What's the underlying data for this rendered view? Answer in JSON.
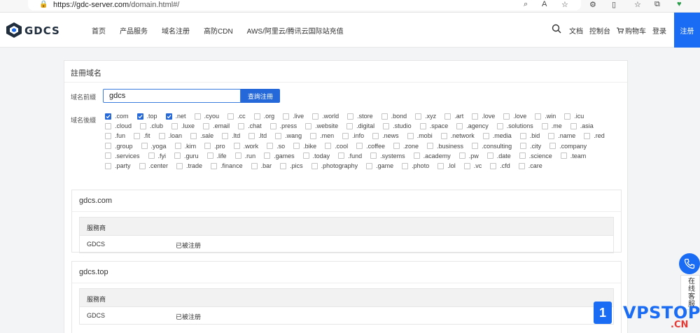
{
  "browser": {
    "url_host": "https://gdc-server.com",
    "url_path": "/domain.html#/"
  },
  "header": {
    "logo_text": "GDCS",
    "nav": [
      "首页",
      "产品服务",
      "域名注册",
      "高防CDN",
      "AWS/阿里云/腾讯云国际站充值"
    ],
    "docs": "文档",
    "console": "控制台",
    "cart": "购物车",
    "login": "登录",
    "register": "注册"
  },
  "panel": {
    "title": "註冊域名",
    "prefix_label": "域名前綴",
    "prefix_value": "gdcs",
    "query_button": "查詢注冊",
    "suffix_label": "域名後綴"
  },
  "tlds": [
    {
      "name": ".com",
      "checked": true
    },
    {
      "name": ".top",
      "checked": true
    },
    {
      "name": ".net",
      "checked": true
    },
    {
      "name": ".cyou",
      "checked": false
    },
    {
      "name": ".cc",
      "checked": false
    },
    {
      "name": ".org",
      "checked": false
    },
    {
      "name": ".live",
      "checked": false
    },
    {
      "name": ".world",
      "checked": false
    },
    {
      "name": ".store",
      "checked": false
    },
    {
      "name": ".bond",
      "checked": false
    },
    {
      "name": ".xyz",
      "checked": false
    },
    {
      "name": ".art",
      "checked": false
    },
    {
      "name": ".love",
      "checked": false
    },
    {
      "name": ".love",
      "checked": false
    },
    {
      "name": ".win",
      "checked": false
    },
    {
      "name": ".icu",
      "checked": false
    },
    {
      "name": ".cloud",
      "checked": false
    },
    {
      "name": ".club",
      "checked": false
    },
    {
      "name": ".luxe",
      "checked": false
    },
    {
      "name": ".email",
      "checked": false
    },
    {
      "name": ".chat",
      "checked": false
    },
    {
      "name": ".press",
      "checked": false
    },
    {
      "name": ".website",
      "checked": false
    },
    {
      "name": ".digital",
      "checked": false
    },
    {
      "name": ".studio",
      "checked": false
    },
    {
      "name": ".space",
      "checked": false
    },
    {
      "name": ".agency",
      "checked": false
    },
    {
      "name": ".solutions",
      "checked": false
    },
    {
      "name": ".me",
      "checked": false
    },
    {
      "name": ".asia",
      "checked": false
    },
    {
      "name": ".fun",
      "checked": false
    },
    {
      "name": ".fit",
      "checked": false
    },
    {
      "name": ".loan",
      "checked": false
    },
    {
      "name": ".sale",
      "checked": false
    },
    {
      "name": ".ltd",
      "checked": false
    },
    {
      "name": ".ltd",
      "checked": false
    },
    {
      "name": ".wang",
      "checked": false
    },
    {
      "name": ".men",
      "checked": false
    },
    {
      "name": ".info",
      "checked": false
    },
    {
      "name": ".news",
      "checked": false
    },
    {
      "name": ".mobi",
      "checked": false
    },
    {
      "name": ".network",
      "checked": false
    },
    {
      "name": ".media",
      "checked": false
    },
    {
      "name": ".bid",
      "checked": false
    },
    {
      "name": ".name",
      "checked": false
    },
    {
      "name": ".red",
      "checked": false
    },
    {
      "name": ".group",
      "checked": false
    },
    {
      "name": ".yoga",
      "checked": false
    },
    {
      "name": ".kim",
      "checked": false
    },
    {
      "name": ".pro",
      "checked": false
    },
    {
      "name": ".work",
      "checked": false
    },
    {
      "name": ".so",
      "checked": false
    },
    {
      "name": ".bike",
      "checked": false
    },
    {
      "name": ".cool",
      "checked": false
    },
    {
      "name": ".coffee",
      "checked": false
    },
    {
      "name": ".zone",
      "checked": false
    },
    {
      "name": ".business",
      "checked": false
    },
    {
      "name": ".consulting",
      "checked": false
    },
    {
      "name": ".city",
      "checked": false
    },
    {
      "name": ".company",
      "checked": false
    },
    {
      "name": ".services",
      "checked": false
    },
    {
      "name": ".fyi",
      "checked": false
    },
    {
      "name": ".guru",
      "checked": false
    },
    {
      "name": ".life",
      "checked": false
    },
    {
      "name": ".run",
      "checked": false
    },
    {
      "name": ".games",
      "checked": false
    },
    {
      "name": ".today",
      "checked": false
    },
    {
      "name": ".fund",
      "checked": false
    },
    {
      "name": ".systems",
      "checked": false
    },
    {
      "name": ".academy",
      "checked": false
    },
    {
      "name": ".pw",
      "checked": false
    },
    {
      "name": ".date",
      "checked": false
    },
    {
      "name": ".science",
      "checked": false
    },
    {
      "name": ".team",
      "checked": false
    },
    {
      "name": ".party",
      "checked": false
    },
    {
      "name": ".center",
      "checked": false
    },
    {
      "name": ".trade",
      "checked": false
    },
    {
      "name": ".finance",
      "checked": false
    },
    {
      "name": ".bar",
      "checked": false
    },
    {
      "name": ".pics",
      "checked": false
    },
    {
      "name": ".photography",
      "checked": false
    },
    {
      "name": ".game",
      "checked": false
    },
    {
      "name": ".photo",
      "checked": false
    },
    {
      "name": ".lol",
      "checked": false
    },
    {
      "name": ".vc",
      "checked": false
    },
    {
      "name": ".cfd",
      "checked": false
    },
    {
      "name": ".care",
      "checked": false
    }
  ],
  "results": [
    {
      "domain": "gdcs.com",
      "header": "服務商",
      "provider": "GDCS",
      "status": "已被注册"
    },
    {
      "domain": "gdcs.top",
      "header": "服務商",
      "provider": "GDCS",
      "status": "已被注册"
    }
  ],
  "widgets": {
    "online_service": "在线客服",
    "vps_badge": "1",
    "vps_text": "VPSTOP",
    "vps_cn": ".CN"
  },
  "colors": {
    "accent": "#2468d9",
    "brand_blue": "#1a6cf5",
    "red": "#e53935"
  }
}
